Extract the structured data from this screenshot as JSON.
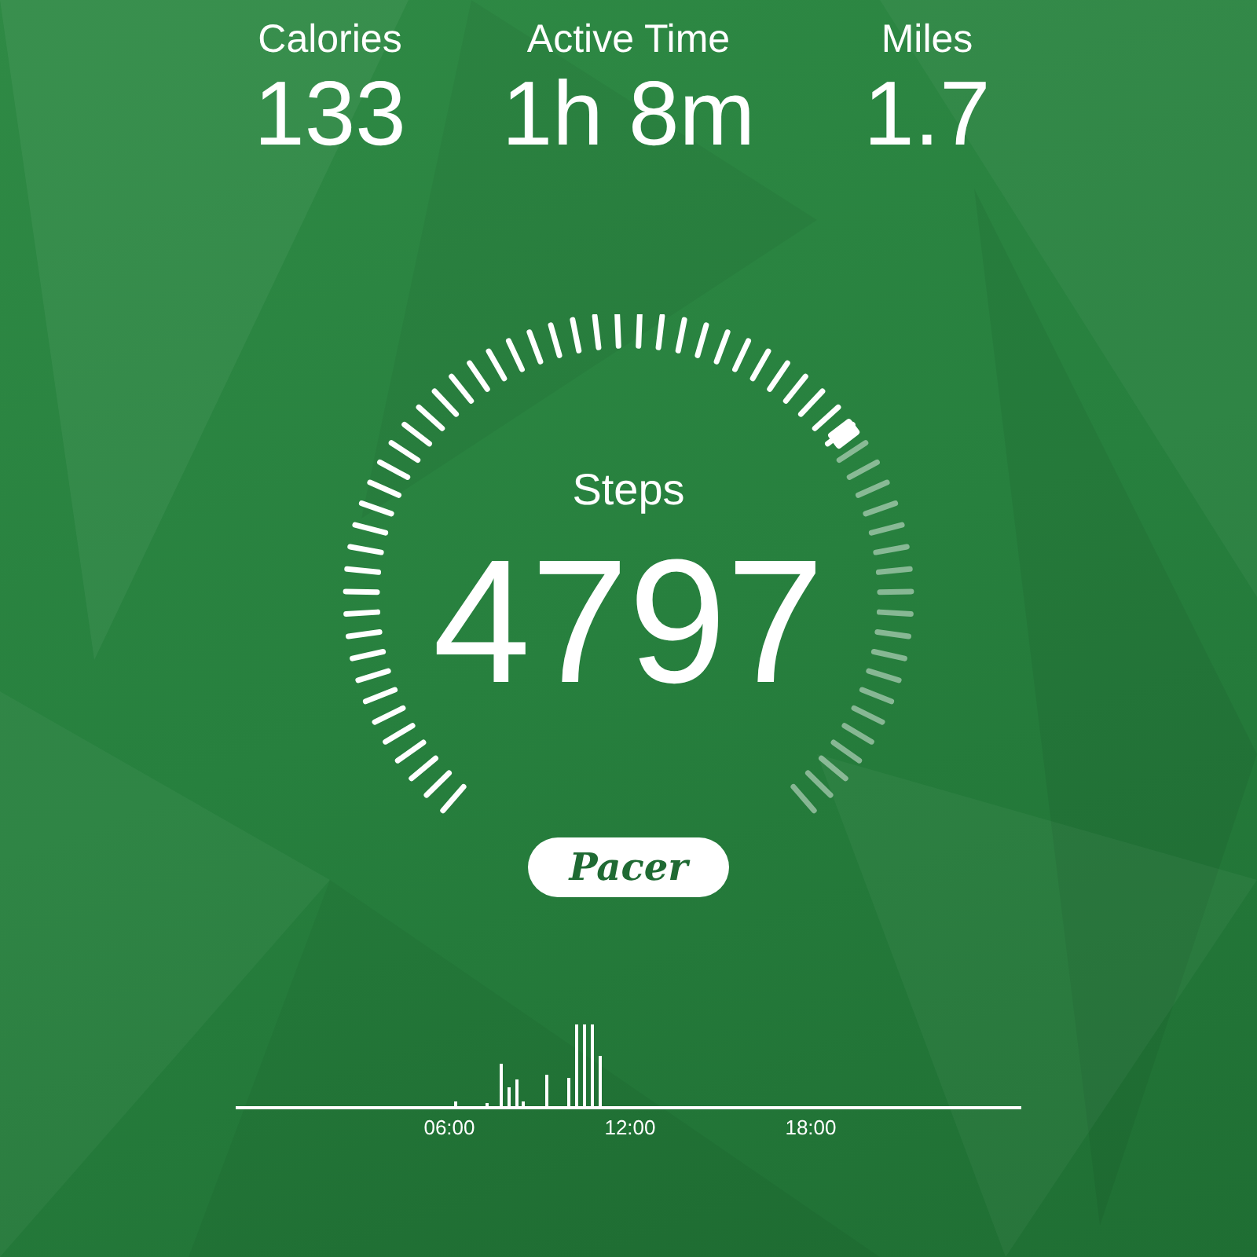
{
  "stats": [
    {
      "label": "Calories",
      "value": "133"
    },
    {
      "label": "Active Time",
      "value": "1h 8m"
    },
    {
      "label": "Miles",
      "value": "1.7"
    }
  ],
  "gauge": {
    "label": "Steps",
    "value": "4797"
  },
  "logo": "Pacer",
  "activity": {
    "time_labels": [
      "06:00",
      "12:00",
      "18:00"
    ]
  }
}
